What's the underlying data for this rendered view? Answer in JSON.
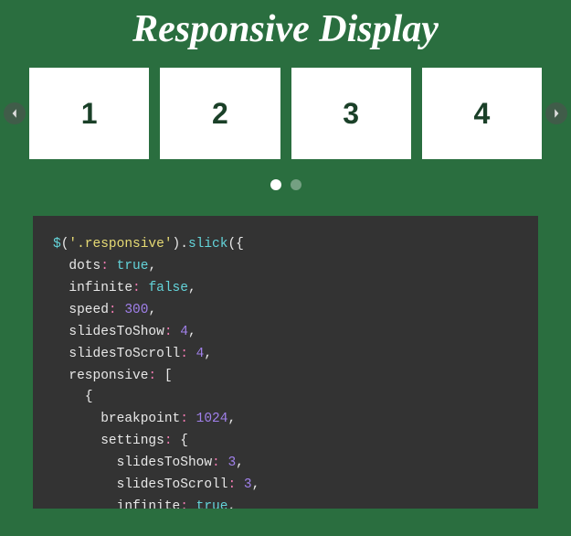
{
  "title": "Responsive Display",
  "slides": [
    "1",
    "2",
    "3",
    "4"
  ],
  "dots_count": 2,
  "active_dot": 0,
  "code_tokens": [
    [
      "fn",
      "$"
    ],
    [
      "pun",
      "("
    ],
    [
      "str",
      "'.responsive'"
    ],
    [
      "pun",
      ")."
    ],
    [
      "fn",
      "slick"
    ],
    [
      "pun",
      "({"
    ],
    [
      "nl",
      ""
    ],
    [
      "ind",
      "  "
    ],
    [
      "key",
      "dots"
    ],
    [
      "col",
      ": "
    ],
    [
      "bool",
      "true"
    ],
    [
      "pun",
      ","
    ],
    [
      "nl",
      ""
    ],
    [
      "ind",
      "  "
    ],
    [
      "key",
      "infinite"
    ],
    [
      "col",
      ": "
    ],
    [
      "bool",
      "false"
    ],
    [
      "pun",
      ","
    ],
    [
      "nl",
      ""
    ],
    [
      "ind",
      "  "
    ],
    [
      "key",
      "speed"
    ],
    [
      "col",
      ": "
    ],
    [
      "num",
      "300"
    ],
    [
      "pun",
      ","
    ],
    [
      "nl",
      ""
    ],
    [
      "ind",
      "  "
    ],
    [
      "key",
      "slidesToShow"
    ],
    [
      "col",
      ": "
    ],
    [
      "num",
      "4"
    ],
    [
      "pun",
      ","
    ],
    [
      "nl",
      ""
    ],
    [
      "ind",
      "  "
    ],
    [
      "key",
      "slidesToScroll"
    ],
    [
      "col",
      ": "
    ],
    [
      "num",
      "4"
    ],
    [
      "pun",
      ","
    ],
    [
      "nl",
      ""
    ],
    [
      "ind",
      "  "
    ],
    [
      "key",
      "responsive"
    ],
    [
      "col",
      ": "
    ],
    [
      "pun",
      "["
    ],
    [
      "nl",
      ""
    ],
    [
      "ind",
      "    "
    ],
    [
      "pun",
      "{"
    ],
    [
      "nl",
      ""
    ],
    [
      "ind",
      "      "
    ],
    [
      "key",
      "breakpoint"
    ],
    [
      "col",
      ": "
    ],
    [
      "num",
      "1024"
    ],
    [
      "pun",
      ","
    ],
    [
      "nl",
      ""
    ],
    [
      "ind",
      "      "
    ],
    [
      "key",
      "settings"
    ],
    [
      "col",
      ": "
    ],
    [
      "pun",
      "{"
    ],
    [
      "nl",
      ""
    ],
    [
      "ind",
      "        "
    ],
    [
      "key",
      "slidesToShow"
    ],
    [
      "col",
      ": "
    ],
    [
      "num",
      "3"
    ],
    [
      "pun",
      ","
    ],
    [
      "nl",
      ""
    ],
    [
      "ind",
      "        "
    ],
    [
      "key",
      "slidesToScroll"
    ],
    [
      "col",
      ": "
    ],
    [
      "num",
      "3"
    ],
    [
      "pun",
      ","
    ],
    [
      "nl",
      ""
    ],
    [
      "ind",
      "        "
    ],
    [
      "key",
      "infinite"
    ],
    [
      "col",
      ": "
    ],
    [
      "bool",
      "true"
    ],
    [
      "pun",
      ","
    ]
  ]
}
